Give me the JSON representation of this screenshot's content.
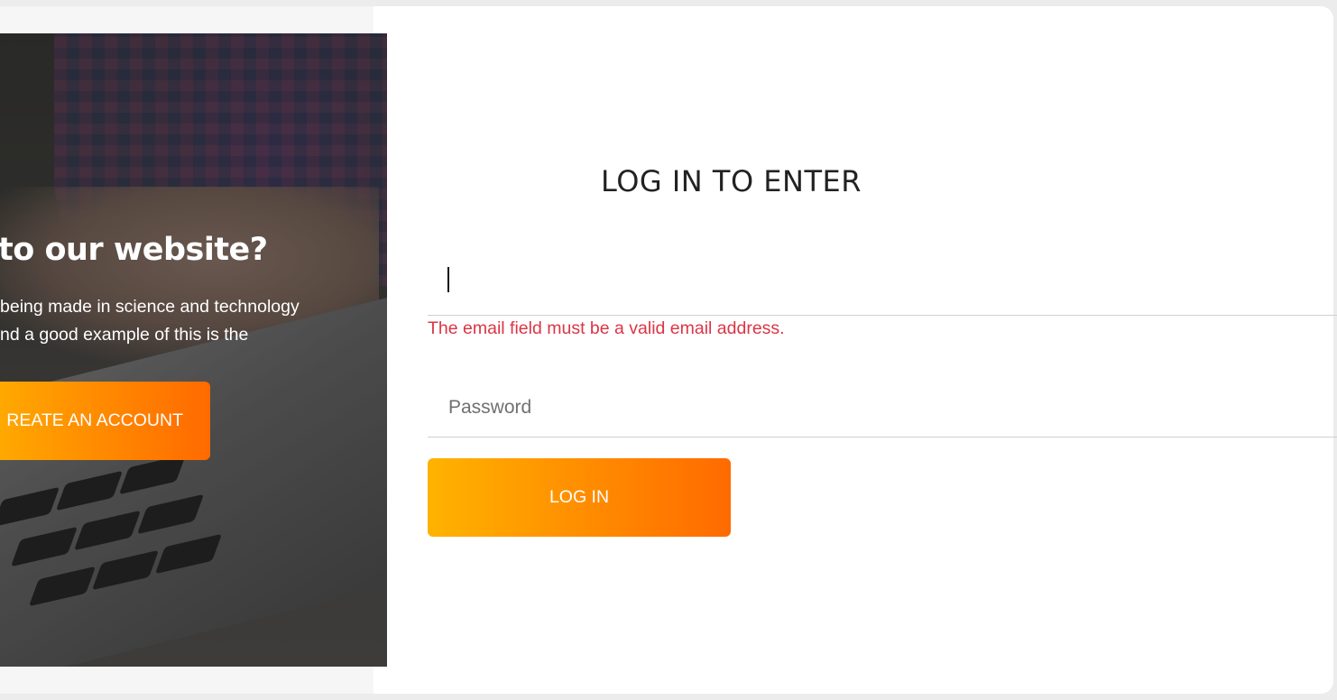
{
  "hero": {
    "title": "to our website?",
    "text_line1": "being made in science and technology",
    "text_line2": "nd a good example of this is the",
    "create_account_label": "REATE AN ACCOUNT"
  },
  "login": {
    "title": "LOG IN TO ENTER",
    "email_value": "",
    "email_error": "The email field must be a valid email address.",
    "password_placeholder": "Password",
    "login_button_label": "LOG IN"
  },
  "colors": {
    "accent_start": "#ffb300",
    "accent_end": "#ff6a00",
    "error": "#dc3545"
  }
}
